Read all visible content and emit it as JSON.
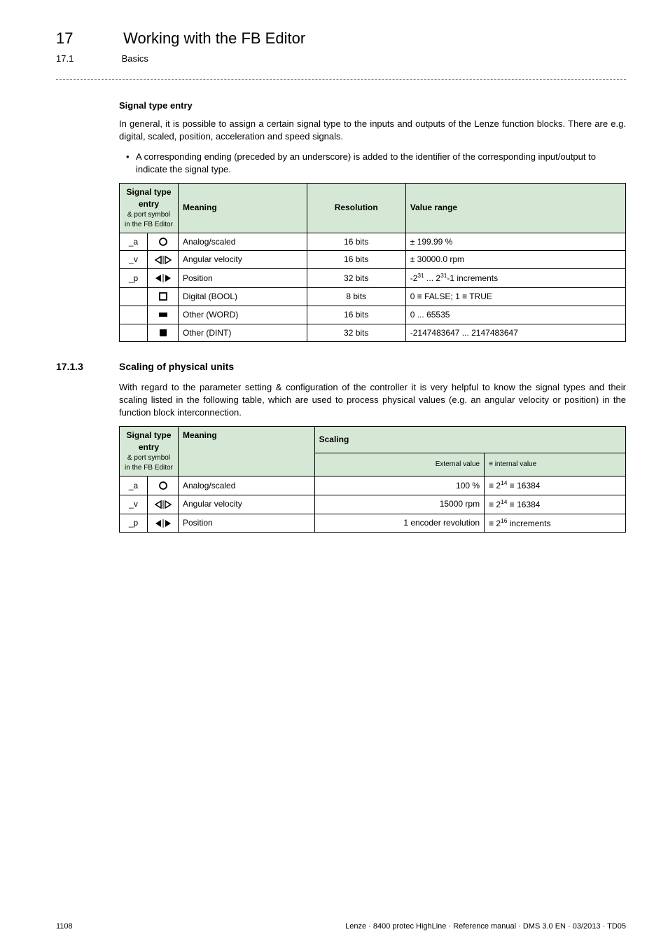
{
  "chapter": {
    "num": "17",
    "title": "Working with the FB Editor"
  },
  "sub": {
    "num": "17.1",
    "title": "Basics"
  },
  "sig": {
    "heading": "Signal type entry",
    "p1": "In general, it is possible to assign a certain signal type to the inputs and outputs of the Lenze function blocks. There are e.g. digital, scaled, position, acceleration and speed signals.",
    "bullet": "A corresponding ending (preceded by an underscore) is added to the identifier of the corresponding input/output to indicate the signal type."
  },
  "table1": {
    "h1": "Signal type entry",
    "h1sub": "& port symbol\nin the FB Editor",
    "h2": "Meaning",
    "h3": "Resolution",
    "h4": "Value range",
    "rows": [
      {
        "sym": "_a",
        "mean": "Analog/scaled",
        "res": "16 bits",
        "range": "± 199.99 %"
      },
      {
        "sym": "_v",
        "mean": "Angular velocity",
        "res": "16 bits",
        "range": "± 30000.0 rpm"
      },
      {
        "sym": "_p",
        "mean": "Position",
        "res": "32 bits",
        "range_html": "-2<sup>31</sup> ... 2<sup>31</sup>-1 increments"
      },
      {
        "sym": "",
        "mean": "Digital (BOOL)",
        "res": "8 bits",
        "range": "0 ≡ FALSE; 1 ≡ TRUE"
      },
      {
        "sym": "",
        "mean": "Other (WORD)",
        "res": "16 bits",
        "range": "0 ... 65535"
      },
      {
        "sym": "",
        "mean": "Other (DINT)",
        "res": "32 bits",
        "range": "-2147483647 ... 2147483647"
      }
    ]
  },
  "sect173": {
    "num": "17.1.3",
    "title": "Scaling of physical units",
    "p": "With regard to the parameter setting & configuration of the controller it is very helpful to know the signal types and their scaling listed in the following table, which are used to process physical values (e.g. an angular velocity or position) in the function block interconnection."
  },
  "table2": {
    "h1": "Signal type entry",
    "h1sub": "& port symbol\nin the FB Editor",
    "h2": "Meaning",
    "h3": "Scaling",
    "h3a": "External value",
    "h3b": "≡ internal value",
    "rows": [
      {
        "sym": "_a",
        "mean": "Analog/scaled",
        "ext": "100 %",
        "int_html": "≡ 2<sup>14</sup> ≡ 16384"
      },
      {
        "sym": "_v",
        "mean": "Angular velocity",
        "ext": "15000 rpm",
        "int_html": "≡ 2<sup>14</sup> ≡ 16384"
      },
      {
        "sym": "_p",
        "mean": "Position",
        "ext": "1 encoder revolution",
        "int_html": "≡ 2<sup>16</sup> increments"
      }
    ]
  },
  "footer": {
    "page": "1108",
    "ref": "Lenze · 8400 protec HighLine · Reference manual · DMS 3.0 EN · 03/2013 · TD05"
  }
}
